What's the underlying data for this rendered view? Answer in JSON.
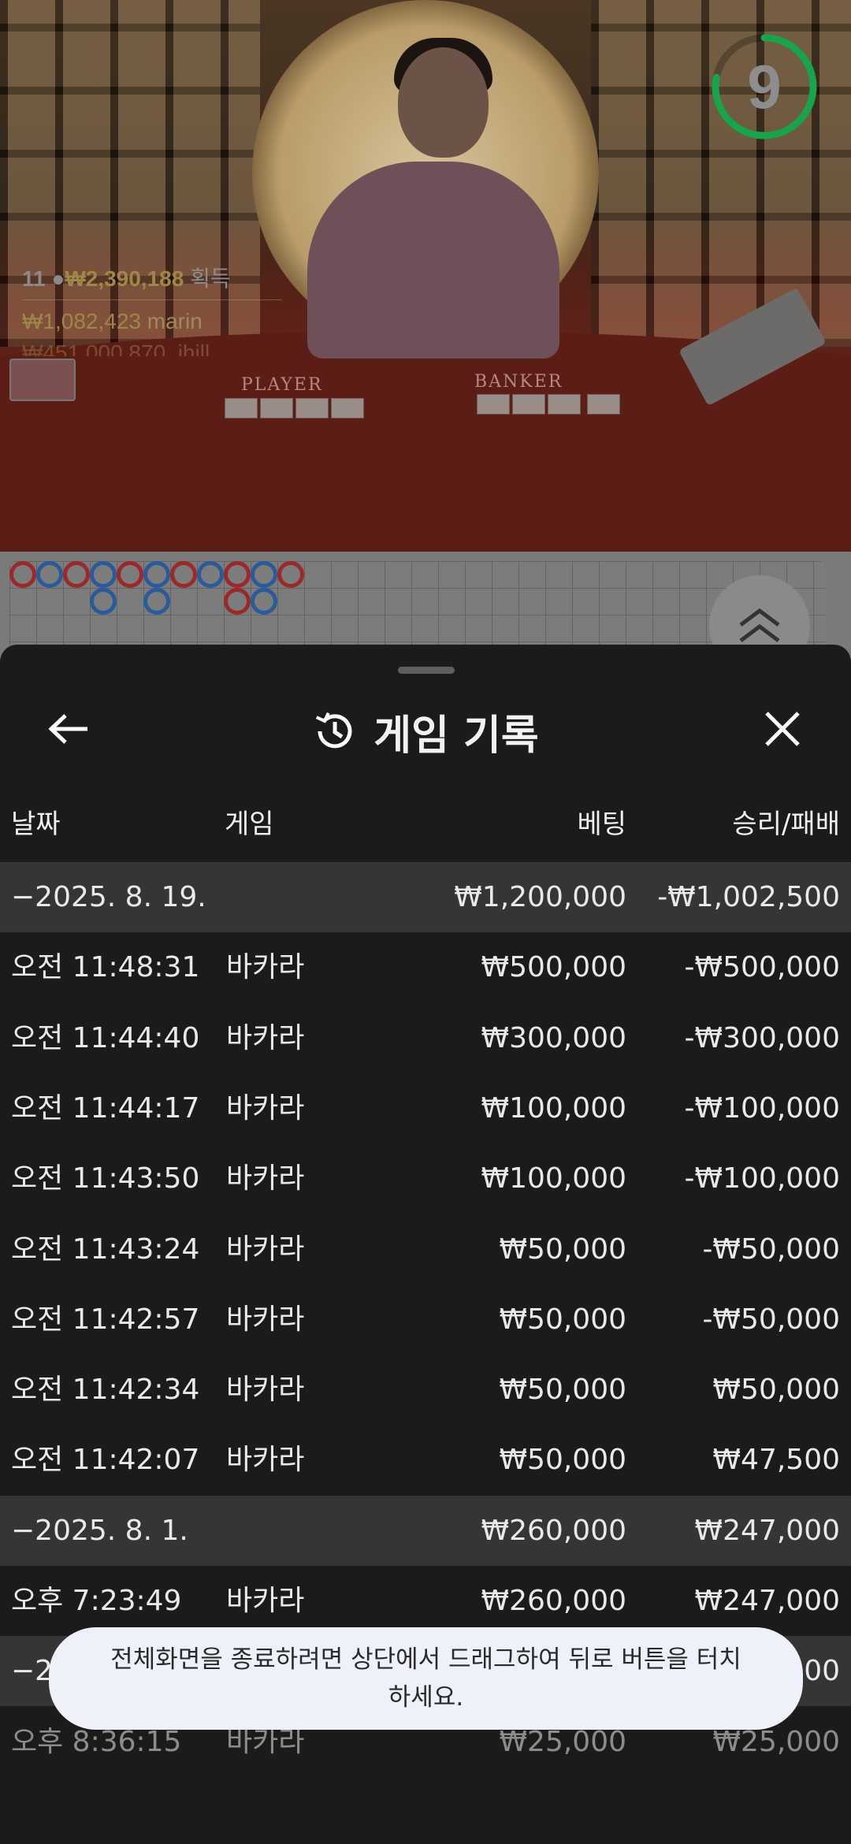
{
  "live": {
    "timer": "9",
    "timer_fraction": 0.78,
    "player_label": "PLAYER",
    "banker_label": "BANKER",
    "winners": [
      {
        "count": "11",
        "amount": "₩2,390,188",
        "label": "획득"
      },
      {
        "amount": "₩1,082,423",
        "name": "marin"
      },
      {
        "amount": "₩451,000",
        "name": "870_jhill"
      }
    ]
  },
  "bead_road": {
    "top_row": [
      "b",
      "p",
      "b",
      "p",
      "b",
      "p",
      "b",
      "p",
      "b",
      "p",
      "b"
    ],
    "second_row": [
      {
        "col": 3,
        "v": "p"
      },
      {
        "col": 5,
        "v": "p"
      },
      {
        "col": 8,
        "v": "b"
      },
      {
        "col": 9,
        "v": "p"
      }
    ]
  },
  "sheet": {
    "title": "게임 기록",
    "columns": {
      "date": "날짜",
      "game": "게임",
      "bet": "베팅",
      "result": "승리/패배"
    },
    "groups": [
      {
        "date": "−2025. 8. 19.",
        "bet": "₩1,200,000",
        "result": "-₩1,002,500",
        "rows": [
          {
            "time": "오전 11:48:31",
            "game": "바카라",
            "bet": "₩500,000",
            "result": "-₩500,000"
          },
          {
            "time": "오전 11:44:40",
            "game": "바카라",
            "bet": "₩300,000",
            "result": "-₩300,000"
          },
          {
            "time": "오전 11:44:17",
            "game": "바카라",
            "bet": "₩100,000",
            "result": "-₩100,000"
          },
          {
            "time": "오전 11:43:50",
            "game": "바카라",
            "bet": "₩100,000",
            "result": "-₩100,000"
          },
          {
            "time": "오전 11:43:24",
            "game": "바카라",
            "bet": "₩50,000",
            "result": "-₩50,000"
          },
          {
            "time": "오전 11:42:57",
            "game": "바카라",
            "bet": "₩50,000",
            "result": "-₩50,000"
          },
          {
            "time": "오전 11:42:34",
            "game": "바카라",
            "bet": "₩50,000",
            "result": "₩50,000"
          },
          {
            "time": "오전 11:42:07",
            "game": "바카라",
            "bet": "₩50,000",
            "result": "₩47,500"
          }
        ]
      },
      {
        "date": "−2025. 8. 1.",
        "bet": "₩260,000",
        "result": "₩247,000",
        "rows": [
          {
            "time": "오후 7:23:49",
            "game": "바카라",
            "bet": "₩260,000",
            "result": "₩247,000"
          }
        ]
      },
      {
        "date": "−2",
        "bet": "",
        "result": "00",
        "rows": [
          {
            "time": "오후 8:36:15",
            "game": "바카라",
            "bet": "₩25,000",
            "result": "₩25,000"
          }
        ]
      }
    ]
  },
  "toast": {
    "message": "전체화면을 종료하려면 상단에서 드래그하여 뒤로 버튼을 터치하세요."
  },
  "colors": {
    "player": "#2b5a9a",
    "banker": "#9a2a2a",
    "timer": "#1aa34a",
    "sheet_bg": "#1b1b1b",
    "group_bg": "#353535"
  }
}
